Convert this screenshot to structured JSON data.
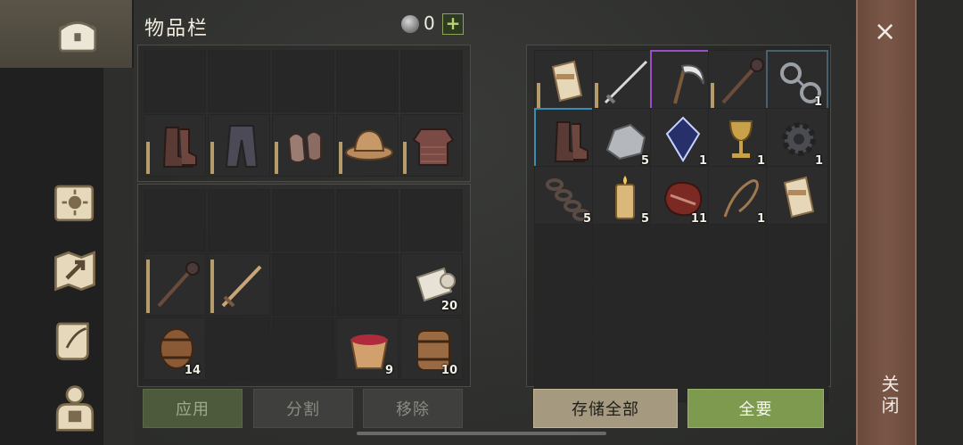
{
  "inventory": {
    "title": "物品栏",
    "currency_count": "0",
    "plus_label": "+"
  },
  "equipment_slots": [
    {
      "name": "boots-slot",
      "icon": "boots-icon"
    },
    {
      "name": "pants-slot",
      "icon": "pants-icon"
    },
    {
      "name": "gloves-slot",
      "icon": "gloves-icon"
    },
    {
      "name": "helmet-slot",
      "icon": "helmet-icon"
    },
    {
      "name": "chainmail-slot",
      "icon": "chainmail-icon"
    }
  ],
  "inventory_items": [
    {
      "icon": "mace-icon",
      "count": ""
    },
    {
      "icon": "sword-icon",
      "count": ""
    },
    {
      "icon": "cloth-roll-icon",
      "count": "20"
    },
    {
      "icon": "barrel-icon",
      "count": "14"
    },
    {
      "icon": "berry-bucket-icon",
      "count": "9"
    },
    {
      "icon": "water-barrel-icon",
      "count": "10"
    }
  ],
  "storage_items": [
    {
      "icon": "scroll-icon",
      "count": ""
    },
    {
      "icon": "longsword-icon",
      "count": ""
    },
    {
      "icon": "scythe-icon",
      "count": ""
    },
    {
      "icon": "mace-icon",
      "count": ""
    },
    {
      "icon": "shackles-icon",
      "count": "1"
    },
    {
      "icon": "boots-icon",
      "count": ""
    },
    {
      "icon": "silver-ore-icon",
      "count": "5"
    },
    {
      "icon": "crystal-icon",
      "count": "1"
    },
    {
      "icon": "goblet-icon",
      "count": "1"
    },
    {
      "icon": "gear-icon",
      "count": "1"
    },
    {
      "icon": "chain-icon",
      "count": "5"
    },
    {
      "icon": "candle-icon",
      "count": "5"
    },
    {
      "icon": "meat-icon",
      "count": "11"
    },
    {
      "icon": "rope-icon",
      "count": "1"
    },
    {
      "icon": "scroll-icon",
      "count": ""
    }
  ],
  "buttons": {
    "apply": "应用",
    "split": "分割",
    "remove": "移除",
    "store_all": "存储全部",
    "take_all": "全要"
  },
  "close": {
    "x": "×",
    "label": "关闭"
  },
  "colors": {
    "accent_green": "#7d9a4e",
    "rare_blue": "#3a8db3",
    "rare_purple": "#9a4fc6"
  }
}
